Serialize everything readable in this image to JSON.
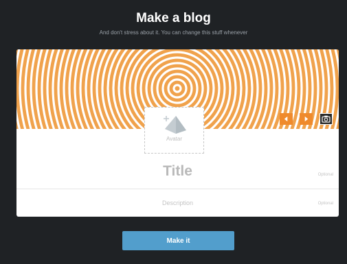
{
  "header": {
    "title": "Make a blog",
    "subtitle": "And don't stress about it. You can change this stuff whenever"
  },
  "banner": {
    "pattern": "concentric-circles",
    "colors": {
      "stripe": "#f0a24c",
      "gap": "#ffffff"
    },
    "controls": {
      "prev_icon": "arrow-left-icon",
      "next_icon": "arrow-right-icon",
      "camera_icon": "camera-icon"
    }
  },
  "avatar": {
    "label": "Avatar",
    "icon": "avatar-placeholder-icon"
  },
  "fields": {
    "title": {
      "placeholder": "Title",
      "hint": "Optional"
    },
    "description": {
      "placeholder": "Description",
      "hint": "Optional"
    }
  },
  "actions": {
    "submit_label": "Make it"
  },
  "colors": {
    "background": "#1f2225",
    "card": "#ffffff",
    "accent_orange": "#ef8a2c",
    "button_blue": "#529ecc"
  }
}
